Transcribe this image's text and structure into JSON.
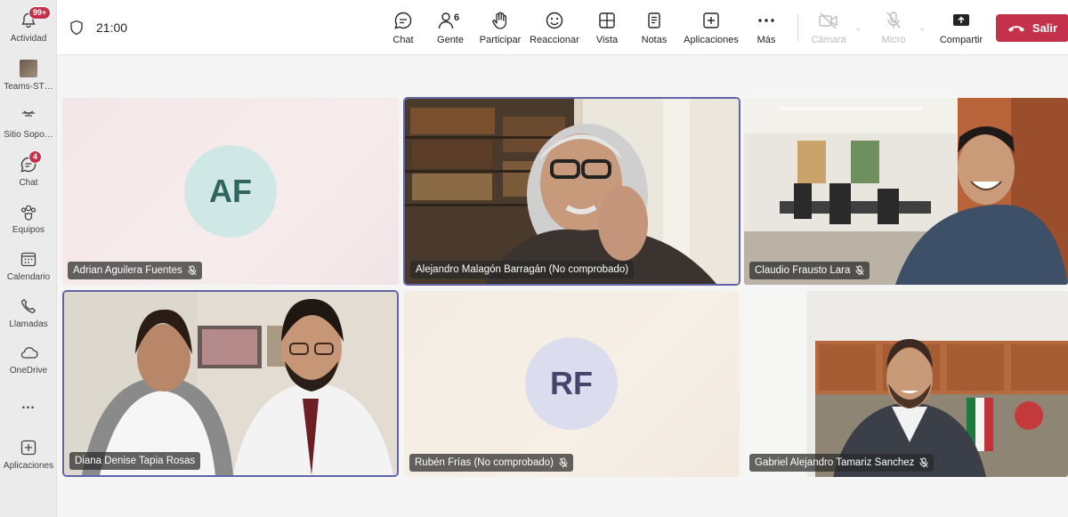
{
  "rail": {
    "items": [
      {
        "label": "Actividad",
        "badge": "99+",
        "icon": "bell-icon"
      },
      {
        "label": "Teams-ST…",
        "icon": "team-thumbnail"
      },
      {
        "label": "Sitio Sopo…",
        "icon": "site-icon"
      },
      {
        "label": "Chat",
        "badge": "4",
        "icon": "chat-icon"
      },
      {
        "label": "Equipos",
        "icon": "teams-icon"
      },
      {
        "label": "Calendario",
        "icon": "calendar-icon"
      },
      {
        "label": "Llamadas",
        "icon": "phone-icon"
      },
      {
        "label": "OneDrive",
        "icon": "cloud-icon"
      },
      {
        "label": "…",
        "icon": "more-icon"
      },
      {
        "label": "Aplicaciones",
        "icon": "add-app-icon"
      }
    ]
  },
  "topbar": {
    "timer": "21:00",
    "buttons": {
      "chat": "Chat",
      "people": "Gente",
      "people_count": "6",
      "raise": "Participar",
      "react": "Reaccionar",
      "view": "Vista",
      "notes": "Notas",
      "apps": "Aplicaciones",
      "more": "Más",
      "camera": "Cámara",
      "mic": "Micro",
      "share": "Compartir",
      "leave": "Salir"
    }
  },
  "participants": [
    {
      "name": "Adrian Aguilera Fuentes",
      "initials": "AF",
      "muted": true,
      "video": false,
      "active": false
    },
    {
      "name": "Alejandro Malagón Barragán (No comprobado)",
      "muted": false,
      "video": true,
      "active": true
    },
    {
      "name": "Claudio Frausto Lara",
      "muted": true,
      "video": true,
      "active": false
    },
    {
      "name": "Diana Denise Tapia Rosas",
      "muted": false,
      "video": true,
      "active": true
    },
    {
      "name": "Rubén Frías (No comprobado)",
      "initials": "RF",
      "muted": true,
      "video": false,
      "active": false
    },
    {
      "name": "Gabriel Alejandro Tamariz Sanchez",
      "muted": true,
      "video": true,
      "active": false
    }
  ],
  "colors": {
    "accent": "#6264a7",
    "leave": "#c4314b",
    "af_avatar_bg": "#cfe8e6",
    "af_avatar_fg": "#2f6661",
    "rf_avatar_bg": "#dcdcef",
    "rf_avatar_fg": "#45456e"
  }
}
